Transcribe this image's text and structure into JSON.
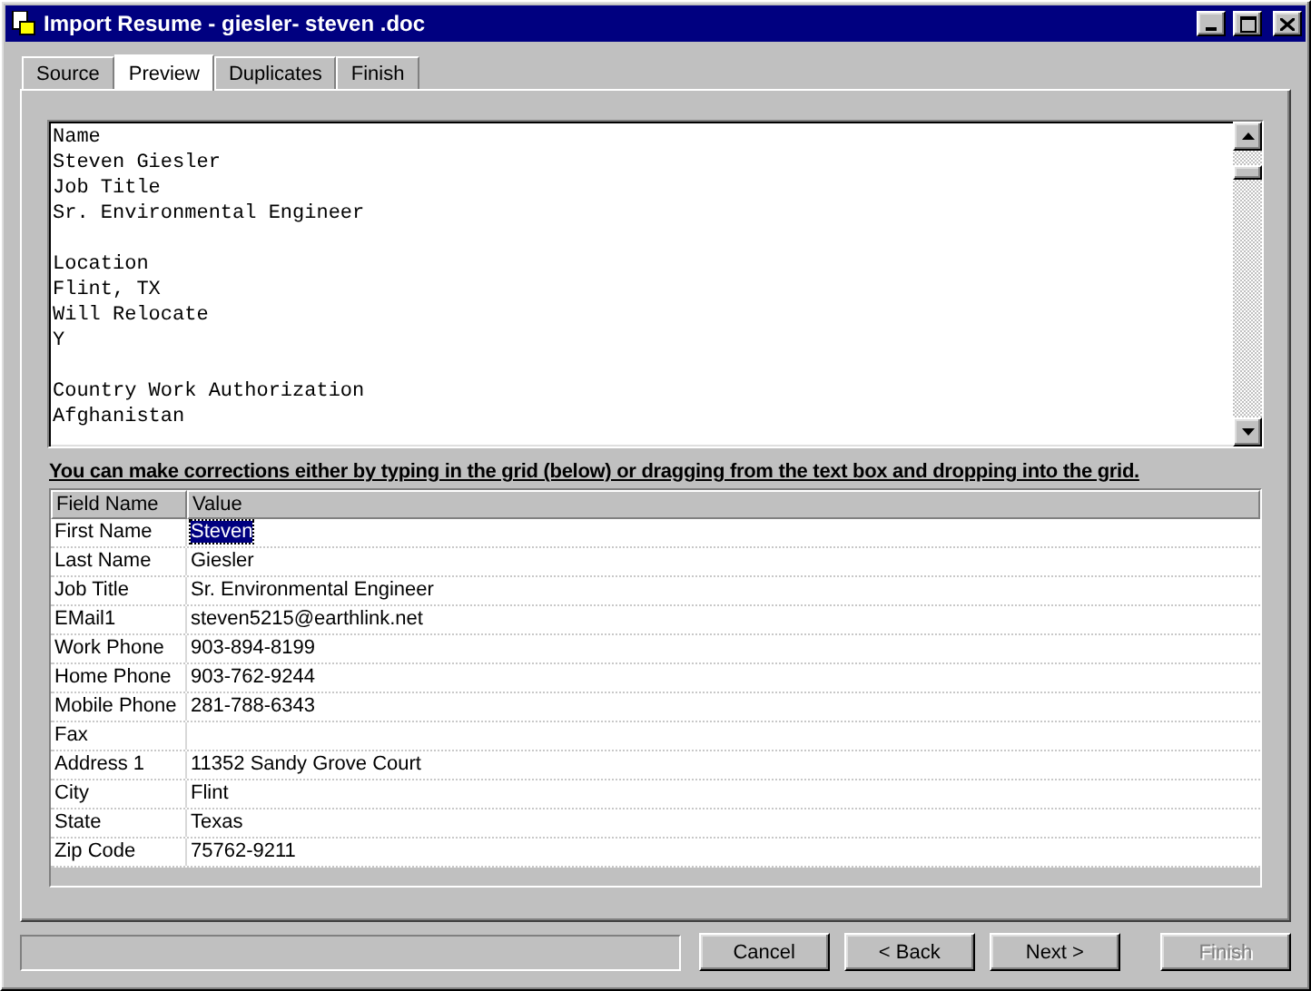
{
  "window": {
    "title": "Import Resume - giesler- steven .doc"
  },
  "tabs": [
    {
      "label": "Source",
      "selected": false
    },
    {
      "label": "Preview",
      "selected": true
    },
    {
      "label": "Duplicates",
      "selected": false
    },
    {
      "label": "Finish",
      "selected": false
    }
  ],
  "preview_text": {
    "blocks": [
      [
        "Name",
        "Steven Giesler",
        "Job Title",
        "Sr. Environmental Engineer"
      ],
      [
        "Location",
        "Flint, TX",
        "Will Relocate",
        "Y"
      ],
      [
        "Country Work Authorization",
        "Afghanistan"
      ]
    ]
  },
  "instruction": "You can make corrections either by typing in the grid (below) or dragging from the text box and dropping into the grid.",
  "grid": {
    "columns": [
      "Field Name",
      "Value"
    ],
    "rows": [
      {
        "field": "First Name",
        "value": "Steven",
        "selected": true
      },
      {
        "field": "Last Name",
        "value": "Giesler",
        "selected": false
      },
      {
        "field": "Job Title",
        "value": "Sr. Environmental Engineer",
        "selected": false
      },
      {
        "field": "EMail1",
        "value": "steven5215@earthlink.net",
        "selected": false
      },
      {
        "field": "Work Phone",
        "value": "903-894-8199",
        "selected": false
      },
      {
        "field": "Home Phone",
        "value": "903-762-9244",
        "selected": false
      },
      {
        "field": "Mobile Phone",
        "value": "281-788-6343",
        "selected": false
      },
      {
        "field": "Fax",
        "selected": false
      },
      {
        "field": "Address 1",
        "value": "11352 Sandy Grove Court",
        "selected": false
      },
      {
        "field": "City",
        "value": "Flint",
        "selected": false
      },
      {
        "field": "State",
        "value": "Texas",
        "selected": false
      },
      {
        "field": "Zip Code",
        "value": "75762-9211",
        "selected": false
      }
    ]
  },
  "buttons": [
    {
      "label": "Cancel",
      "disabled": false
    },
    {
      "label": "< Back",
      "disabled": false
    },
    {
      "label": "Next >",
      "disabled": false
    },
    {
      "label": "Finish",
      "disabled": true
    }
  ]
}
